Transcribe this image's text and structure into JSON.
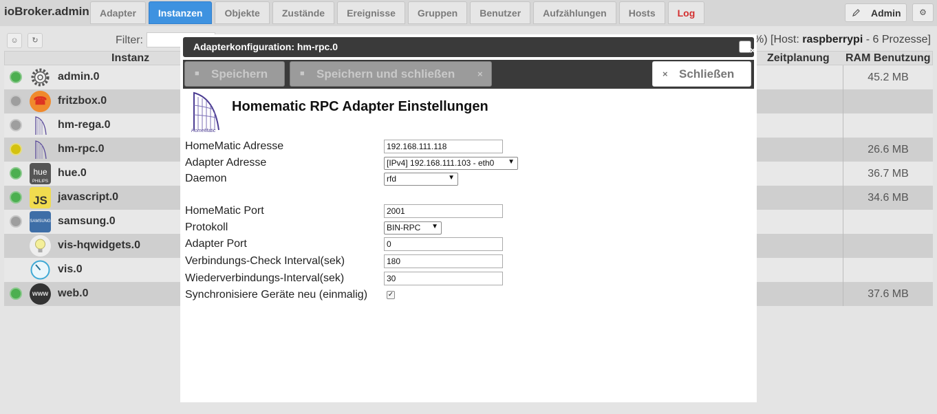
{
  "app": {
    "brand": "ioBroker.admin"
  },
  "tabs": [
    {
      "label": "Adapter",
      "active": false
    },
    {
      "label": "Instanzen",
      "active": true
    },
    {
      "label": "Objekte",
      "active": false
    },
    {
      "label": "Zustände",
      "active": false
    },
    {
      "label": "Ereignisse",
      "active": false
    },
    {
      "label": "Gruppen",
      "active": false
    },
    {
      "label": "Benutzer",
      "active": false
    },
    {
      "label": "Aufzählungen",
      "active": false
    },
    {
      "label": "Hosts",
      "active": false
    },
    {
      "label": "Log",
      "active": false
    }
  ],
  "user": {
    "name": "Admin"
  },
  "toolbar": {
    "filter_label": "Filter:",
    "host_prefix": "%) [Host: ",
    "host_name": "raspberrypi",
    "host_suffix": " - 6 Prozesse]"
  },
  "table": {
    "headers": {
      "instance": "Instanz",
      "schedule": "Zeitplanung",
      "ram": "RAM Benutzung"
    },
    "rows": [
      {
        "name": "admin.0",
        "status": "green",
        "icon": "gear-icon",
        "ram": "45.2 MB"
      },
      {
        "name": "fritzbox.0",
        "status": "grey",
        "icon": "phone-icon",
        "ram": ""
      },
      {
        "name": "hm-rega.0",
        "status": "grey",
        "icon": "homematic-logo-icon",
        "ram": ""
      },
      {
        "name": "hm-rpc.0",
        "status": "yellow",
        "icon": "homematic-logo-icon",
        "ram": "26.6 MB"
      },
      {
        "name": "hue.0",
        "status": "green",
        "icon": "hue-icon",
        "ram": "36.7 MB"
      },
      {
        "name": "javascript.0",
        "status": "green",
        "icon": "js-icon",
        "ram": "34.6 MB"
      },
      {
        "name": "samsung.0",
        "status": "grey",
        "icon": "samsung-icon",
        "ram": ""
      },
      {
        "name": "vis-hqwidgets.0",
        "status": "none",
        "icon": "bulb-icon",
        "ram": ""
      },
      {
        "name": "vis.0",
        "status": "none",
        "icon": "gauge-icon",
        "ram": ""
      },
      {
        "name": "web.0",
        "status": "green",
        "icon": "www-icon",
        "ram": "37.6 MB"
      }
    ],
    "icon_labels": {
      "hue": "hue",
      "hue_sub": "PHILIPS",
      "js": "JS",
      "samsung": "SAMSUNG",
      "www": "www"
    }
  },
  "dialog": {
    "title": "Adapterkonfiguration: hm-rpc.0",
    "save_label": "Speichern",
    "save_close_label": "Speichern und schließen",
    "close_label": "Schließen",
    "heading": "Homematic RPC Adapter Einstellungen",
    "logo_text": "HomeMatic",
    "fields": {
      "homematic_address": {
        "label": "HomeMatic Adresse",
        "value": "192.168.111.118"
      },
      "adapter_address": {
        "label": "Adapter Adresse",
        "value": "[IPv4] 192.168.111.103 - eth0"
      },
      "daemon": {
        "label": "Daemon",
        "value": "rfd"
      },
      "homematic_port": {
        "label": "HomeMatic Port",
        "value": "2001"
      },
      "protocol": {
        "label": "Protokoll",
        "value": "BIN-RPC"
      },
      "adapter_port": {
        "label": "Adapter Port",
        "value": "0"
      },
      "check_interval": {
        "label": "Verbindungs-Check Interval(sek)",
        "value": "180"
      },
      "reconnect_interval": {
        "label": "Wiederverbindungs-Interval(sek)",
        "value": "30"
      },
      "sync_devices": {
        "label": "Synchronisiere Geräte neu (einmalig)",
        "checked": true
      }
    }
  }
}
